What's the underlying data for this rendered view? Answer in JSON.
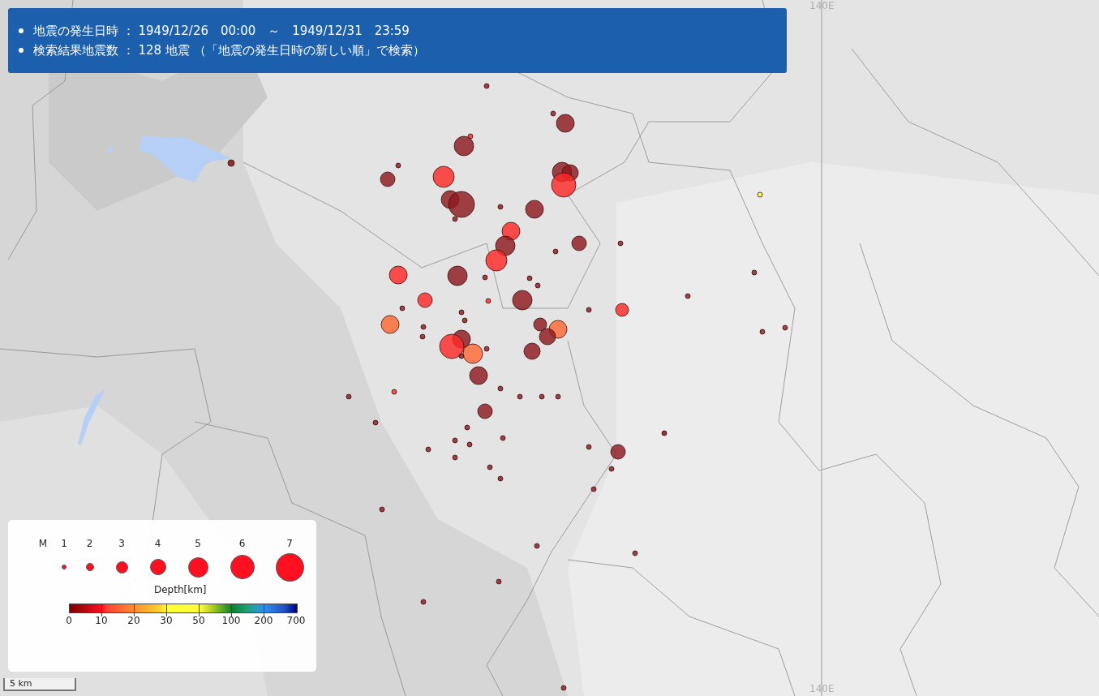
{
  "summary": [
    {
      "text": "地震の発生日時 ： 1949/12/26　00:00　～　1949/12/31　23:59"
    },
    {
      "text": "検索結果地震数 ： 128 地震 （「地震の発生日時の新しい順」で検索）"
    }
  ],
  "legend": {
    "magnitude_label": "M",
    "magnitudes": [
      "1",
      "2",
      "3",
      "4",
      "5",
      "6",
      "7"
    ],
    "depth_title": "Depth[km]",
    "depth_ticks": [
      "0",
      "10",
      "20",
      "30",
      "50",
      "100",
      "200",
      "700"
    ]
  },
  "scale": "5 km",
  "graticule_labels": [
    "140E",
    "140E"
  ]
}
